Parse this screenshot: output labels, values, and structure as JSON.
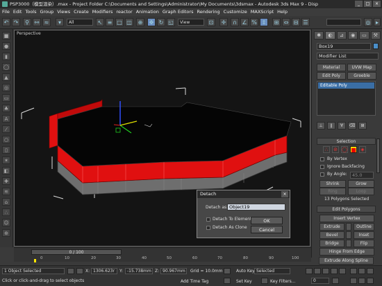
{
  "titlebar": {
    "title": "PSP3000（模型渲染）.max   - Project Folder  C:\\Documents and Settings\\Administrator\\My Documents\\3dsmax   - Autodesk 3ds Max 9   - Disp",
    "buttons": [
      "_",
      "□",
      "×"
    ]
  },
  "menubar": {
    "items": [
      "File",
      "Edit",
      "Tools",
      "Group",
      "Views",
      "Create",
      "Modifiers",
      "reactor",
      "Animation",
      "Graph Editors",
      "Rendering",
      "Customize",
      "MAXScript",
      "Help"
    ]
  },
  "toolbar": {
    "selection_filter": "All",
    "coordinate_system": "View"
  },
  "viewport": {
    "label": "Perspective"
  },
  "dialog": {
    "title": "Detach",
    "close": "×",
    "detach_as_label": "Detach as:",
    "detach_as_value": "Object19",
    "detach_to_element": "Detach To Element",
    "detach_as_clone": "Detach As Clone",
    "ok": "OK",
    "cancel": "Cancel"
  },
  "command_panel": {
    "object_name": "Box19",
    "modifier_list": "Modifier List",
    "buttons": [
      "Material",
      "UVW Map",
      "Edit Poly",
      "Greeble"
    ],
    "stack_item": "Editable Poly",
    "selection_rollout": "Selection",
    "by_vertex": "By Vertex",
    "ignore_backfacing": "Ignore Backfacing",
    "by_angle": "By Angle:",
    "by_angle_value": "45.0",
    "shrink": "Shrink",
    "grow": "Grow",
    "ring": "Ring",
    "loop": "Loop",
    "selection_count": "13 Polygons Selected",
    "edit_polygons_rollout": "Edit Polygons",
    "insert_vertex": "Insert Vertex",
    "extrude": "Extrude",
    "outline": "Outline",
    "bevel": "Bevel",
    "inset": "Inset",
    "bridge": "Bridge",
    "flip": "Flip",
    "hinge_from_edge": "Hinge From Edge",
    "extrude_along_spline": "Extrude Along Spline"
  },
  "timeline": {
    "frame_display": "0 / 100",
    "ticks": [
      "0",
      "10",
      "20",
      "30",
      "40",
      "50",
      "60",
      "70",
      "80",
      "90",
      "100"
    ]
  },
  "statusbar": {
    "selection_status": "1 Object Selected",
    "prompt": "Click or click-and-drag to select objects",
    "x_label": "X:",
    "x_value": "1306.623r",
    "y_label": "Y:",
    "y_value": "-15.738mm",
    "z_label": "Z:",
    "z_value": "90.967mm",
    "grid": "Grid = 10.0mm",
    "add_time_tag": "Add Time Tag",
    "auto_key": "Auto Key",
    "set_key": "Set Key",
    "key_mode": "Selected",
    "key_filters": "Key Filters...",
    "frame_value": "0"
  }
}
